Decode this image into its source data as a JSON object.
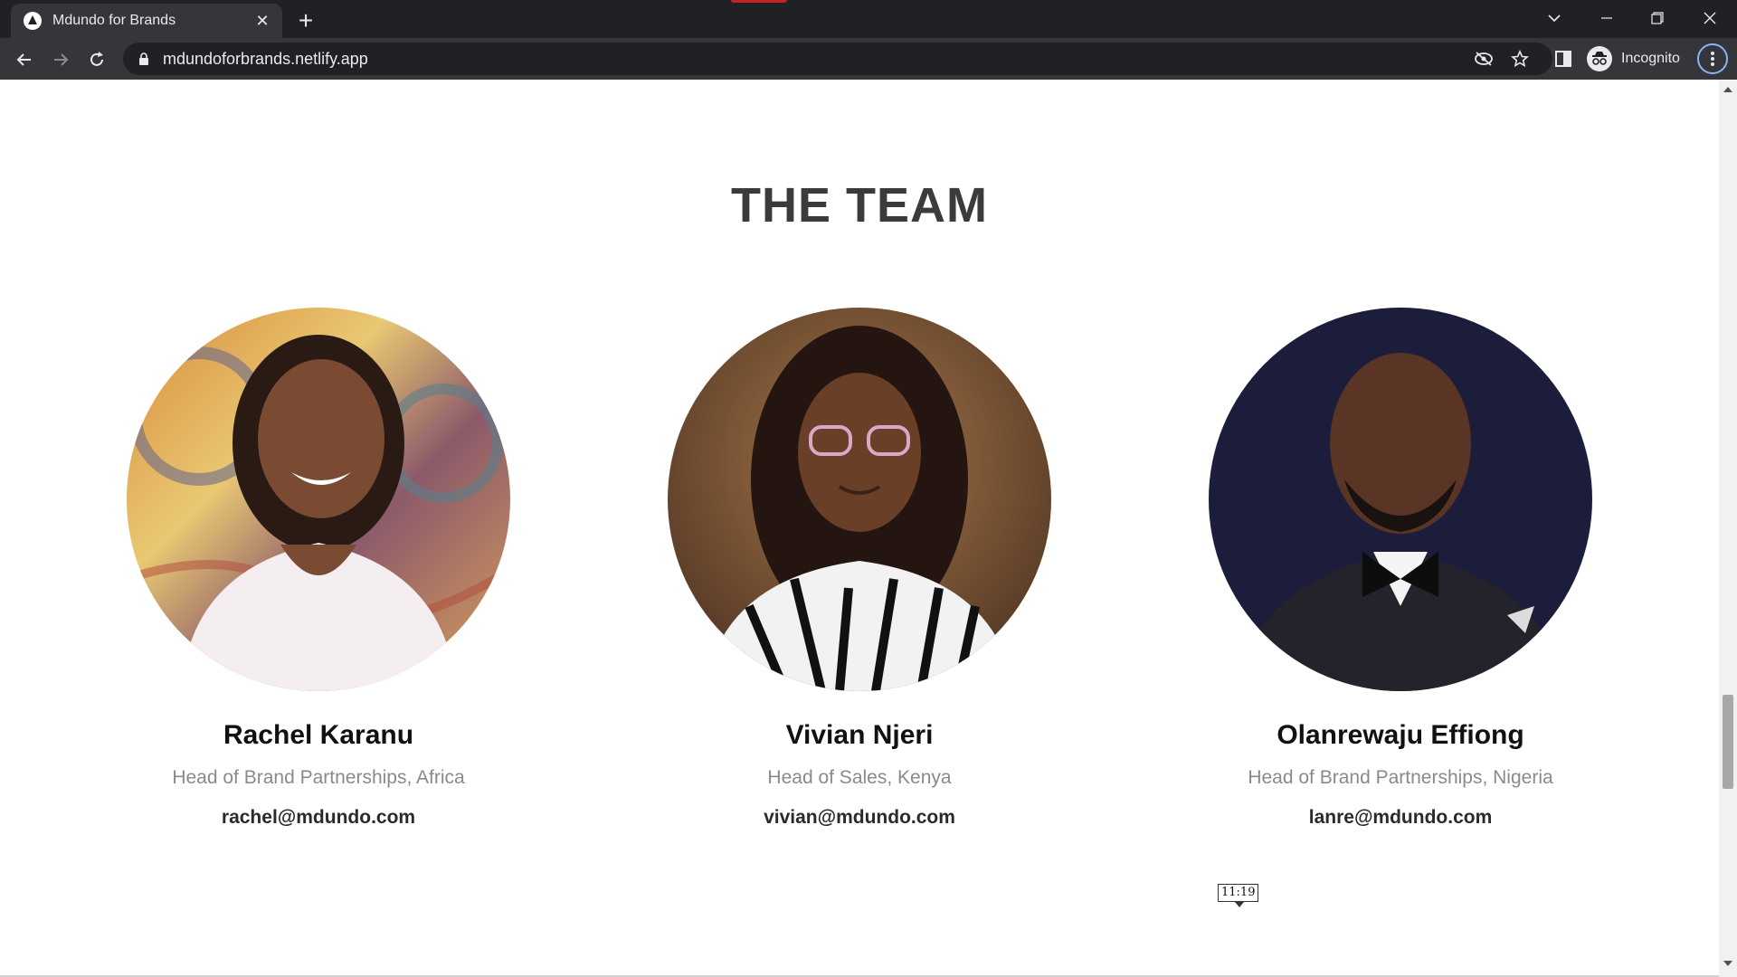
{
  "browser": {
    "tab_title": "Mdundo for Brands",
    "url": "mdundoforbrands.netlify.app",
    "profile_label": "Incognito"
  },
  "page": {
    "section_title": "THE TEAM",
    "team": [
      {
        "name": "Rachel Karanu",
        "role": "Head of Brand Partnerships, Africa",
        "email": "rachel@mdundo.com"
      },
      {
        "name": "Vivian Njeri",
        "role": "Head of Sales, Kenya",
        "email": "vivian@mdundo.com"
      },
      {
        "name": "Olanrewaju Effiong",
        "role": "Head of Brand Partnerships, Nigeria",
        "email": "lanre@mdundo.com"
      }
    ],
    "tooltip_text": "11:19"
  }
}
